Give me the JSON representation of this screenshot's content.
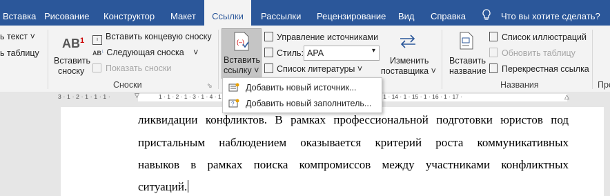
{
  "tabs": [
    {
      "label": "Вставка"
    },
    {
      "label": "Рисование"
    },
    {
      "label": "Конструктор"
    },
    {
      "label": "Макет"
    },
    {
      "label": "Ссылки"
    },
    {
      "label": "Рассылки"
    },
    {
      "label": "Рецензирование"
    },
    {
      "label": "Вид"
    },
    {
      "label": "Справка"
    }
  ],
  "tell_me": "Что вы хотите сделать?",
  "toc": {
    "add_text": "ь текст",
    "update_table": "ь таблицу"
  },
  "footnotes": {
    "insert_footnote": "Вставить сноску",
    "insert_endnote": "Вставить концевую сноску",
    "next_footnote": "Следующая сноска",
    "show_notes": "Показать сноски",
    "group": "Сноски"
  },
  "citations": {
    "insert_citation_1": "Вставить",
    "insert_citation_2": "ссылку",
    "manage_sources": "Управление источниками",
    "style_label": "Стиль:",
    "style_value": "APA",
    "bibliography": "Список литературы",
    "update_1": "Изменить",
    "update_2": "поставщика"
  },
  "captions": {
    "insert_caption_1": "Вставить",
    "insert_caption_2": "название",
    "table_of_figures": "Список иллюстраций",
    "update_table": "Обновить таблицу",
    "cross_reference": "Перекрестная ссылка",
    "group": "Названия",
    "next_group": "Пре"
  },
  "dropdown": [
    {
      "label": "Добавить новый источник..."
    },
    {
      "label": "Добавить новый заполнитель..."
    }
  ],
  "ruler": {
    "left": "3 · 1 · 2 · 1 · 1 · 1 ·",
    "right": "1 · 1 · 2 · 1 · 3 · 1 · 4 · 1 · 5 · 1 · 6 · 1 · 7 · 1 · 8 · 1 · 9 · 1 · 10 · 1 · 11 · 1 · 12 · 1 · 13 · 1 · 14 · 1 · 15 · 1 · 16 · 1 · 17 ·"
  },
  "document": {
    "lines": [
      "ликвидации конфликтов. В рамках профессиональной подготовки юристов под",
      "пристальным наблюдением оказывается критерий роста коммуникативных",
      "навыков в рамках поиска компромиссов между участниками конфликтных",
      "ситуаций."
    ]
  }
}
